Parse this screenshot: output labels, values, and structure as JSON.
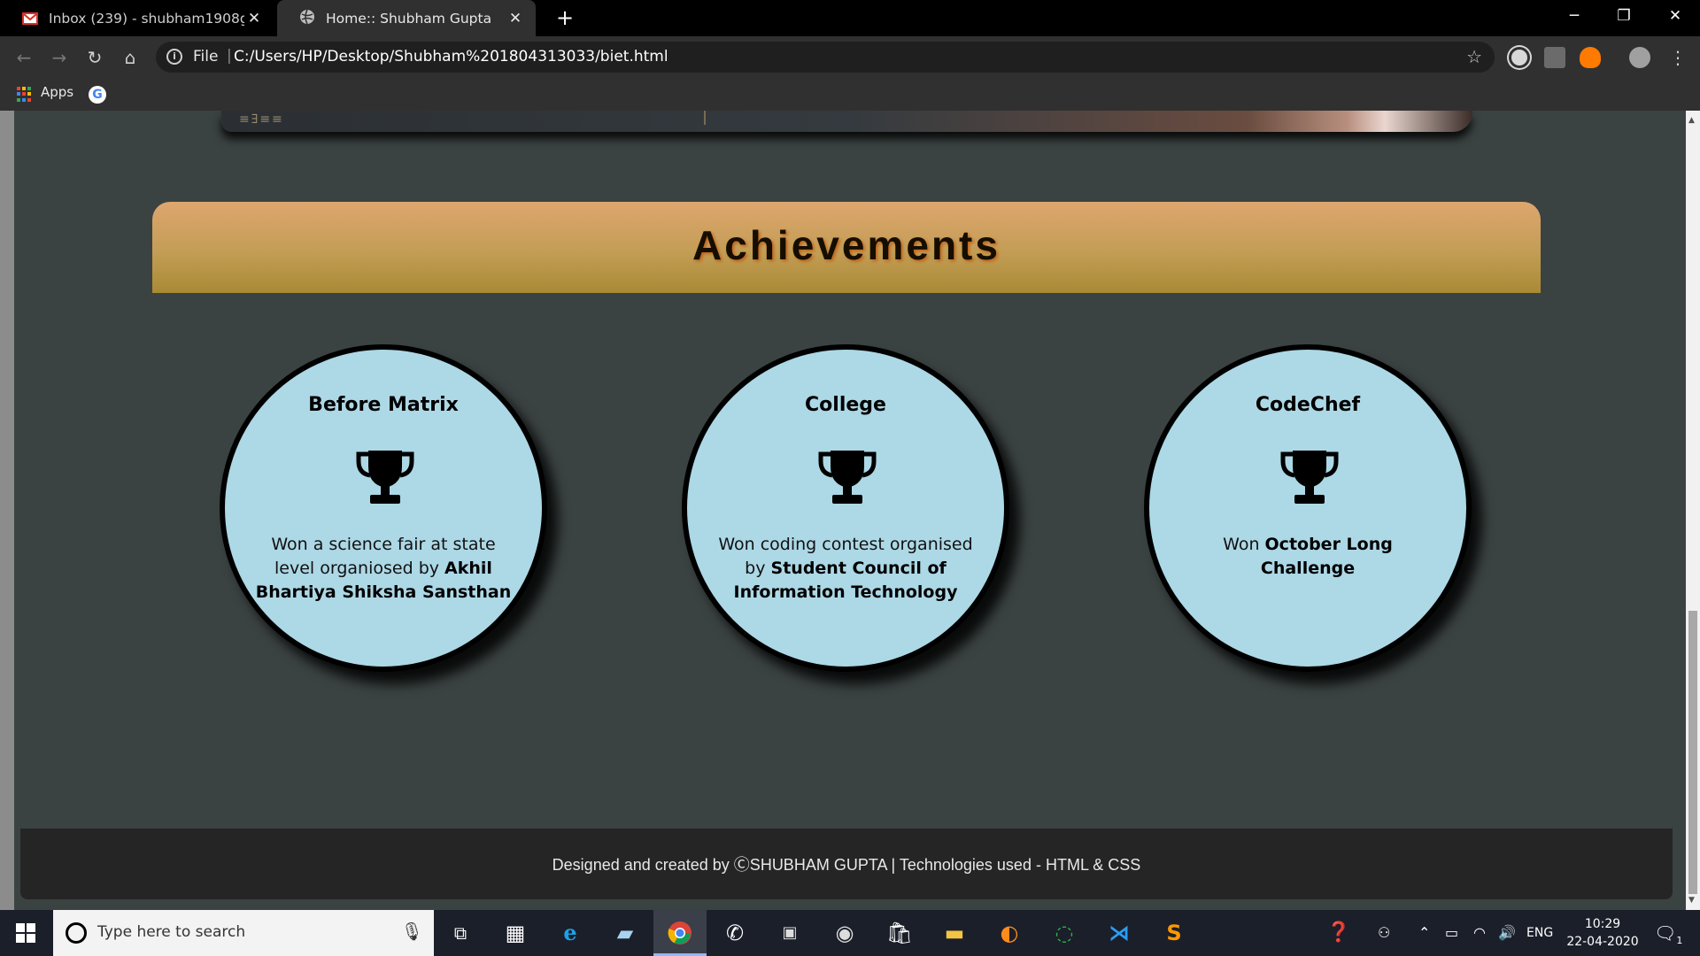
{
  "tabs": [
    {
      "title": "Inbox (239) - shubham1908gupt",
      "icon": "gmail-icon",
      "active": false
    },
    {
      "title": "Home:: Shubham Gupta",
      "icon": "globe-icon",
      "active": true
    }
  ],
  "window_controls": {
    "minimize": "─",
    "restore": "❐",
    "close": "✕"
  },
  "toolbar": {
    "scheme": "File",
    "url": "C:/Users/HP/Desktop/Shubham%201804313033/biet.html",
    "back": "←",
    "forward": "→",
    "reload": "↻",
    "home": "⌂",
    "star": "☆",
    "menu": "⋮"
  },
  "bookmarks": {
    "apps_label": "Apps",
    "google": "G"
  },
  "page": {
    "heading": "Achievements",
    "cards": [
      {
        "title": "Before Matrix",
        "text_plain": "Won a science fair at state level organiosed by ",
        "text_bold": "Akhil Bhartiya Shiksha Sansthan"
      },
      {
        "title": "College",
        "text_plain": "Won coding contest organised by ",
        "text_bold": "Student Council of Information Technology"
      },
      {
        "title": "CodeChef",
        "text_plain": "Won ",
        "text_bold": "October Long Challenge"
      }
    ],
    "footer": "Designed and created by ⒸSHUBHAM GUPTA | Technologies used - HTML & CSS"
  },
  "taskbar": {
    "search_placeholder": "Type here to search",
    "language": "ENG",
    "time": "10:29",
    "date": "22-04-2020",
    "notification_count": "1"
  },
  "colors": {
    "page_bg": "#3b4342",
    "card_bg": "#add8e6",
    "header_gold": "#c39d55",
    "footer_bg": "#252525"
  }
}
